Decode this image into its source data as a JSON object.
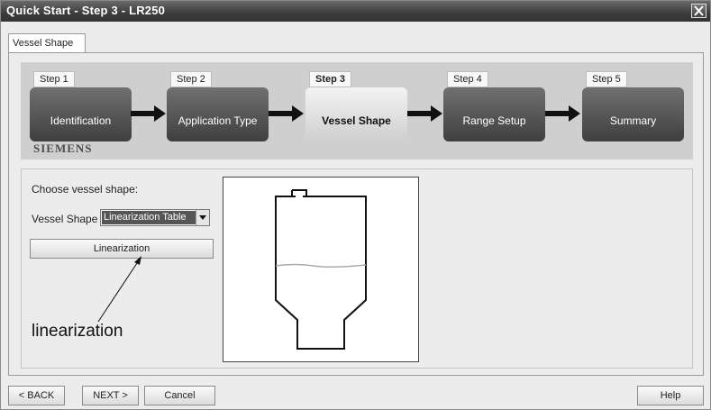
{
  "window": {
    "title": "Quick Start - Step 3 - LR250"
  },
  "tab": {
    "label": "Vessel Shape"
  },
  "steps": [
    {
      "number": "Step 1",
      "label": "Identification",
      "active": false
    },
    {
      "number": "Step 2",
      "label": "Application Type",
      "active": false
    },
    {
      "number": "Step 3",
      "label": "Vessel Shape",
      "active": true
    },
    {
      "number": "Step 4",
      "label": "Range Setup",
      "active": false
    },
    {
      "number": "Step 5",
      "label": "Summary",
      "active": false
    }
  ],
  "brand": "SIEMENS",
  "form": {
    "choose_label": "Choose vessel shape:",
    "vessel_shape_label": "Vessel Shape",
    "vessel_shape_value": "Linearization Table",
    "linearization_button": "Linearization"
  },
  "annotation": "linearization",
  "buttons": {
    "back": "< BACK",
    "next": "NEXT >",
    "cancel": "Cancel",
    "help": "Help"
  },
  "icons": {
    "close": "close-icon",
    "dropdown": "chevron-down-icon",
    "arrow": "arrow-right-icon"
  }
}
